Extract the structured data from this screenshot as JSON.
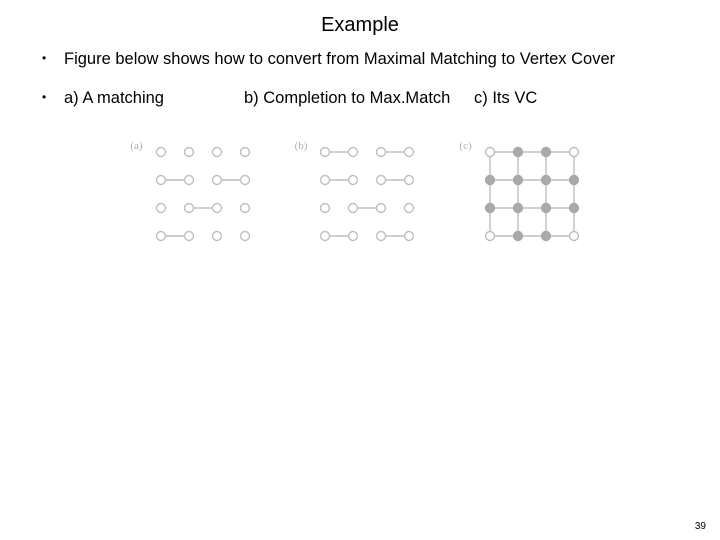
{
  "title": "Example",
  "bullet1": "Figure below shows how to convert from Maximal Matching to  Vertex Cover",
  "caption_a": "a) A matching",
  "caption_b": "b) Completion to Max.Match",
  "caption_c": "c) Its VC",
  "panel_labels": {
    "a": "(a)",
    "b": "(b)",
    "c": "(c)"
  },
  "page_number": "39",
  "chart_data": [
    {
      "type": "diagram",
      "id": "a",
      "title": "A matching",
      "grid": "4x4",
      "nodes_filled": [],
      "edges": [
        [
          [
            0,
            1
          ],
          [
            1,
            1
          ]
        ],
        [
          [
            2,
            1
          ],
          [
            3,
            1
          ]
        ],
        [
          [
            1,
            2
          ],
          [
            2,
            2
          ]
        ],
        [
          [
            0,
            3
          ],
          [
            1,
            3
          ]
        ]
      ]
    },
    {
      "type": "diagram",
      "id": "b",
      "title": "Completion to Max.Match",
      "grid": "4x4",
      "nodes_filled": [],
      "edges": [
        [
          [
            0,
            0
          ],
          [
            1,
            0
          ]
        ],
        [
          [
            2,
            0
          ],
          [
            3,
            0
          ]
        ],
        [
          [
            0,
            1
          ],
          [
            1,
            1
          ]
        ],
        [
          [
            2,
            1
          ],
          [
            3,
            1
          ]
        ],
        [
          [
            1,
            2
          ],
          [
            2,
            2
          ]
        ],
        [
          [
            0,
            3
          ],
          [
            1,
            3
          ]
        ],
        [
          [
            2,
            3
          ],
          [
            3,
            3
          ]
        ]
      ]
    },
    {
      "type": "diagram",
      "id": "c",
      "title": "Its VC",
      "grid": "4x4",
      "nodes_filled": [
        [
          1,
          0
        ],
        [
          2,
          0
        ],
        [
          0,
          1
        ],
        [
          1,
          1
        ],
        [
          2,
          1
        ],
        [
          3,
          1
        ],
        [
          0,
          2
        ],
        [
          1,
          2
        ],
        [
          2,
          2
        ],
        [
          3,
          2
        ],
        [
          1,
          3
        ],
        [
          2,
          3
        ]
      ],
      "edges": [
        [
          [
            0,
            0
          ],
          [
            1,
            0
          ]
        ],
        [
          [
            1,
            0
          ],
          [
            2,
            0
          ]
        ],
        [
          [
            2,
            0
          ],
          [
            3,
            0
          ]
        ],
        [
          [
            0,
            1
          ],
          [
            1,
            1
          ]
        ],
        [
          [
            1,
            1
          ],
          [
            2,
            1
          ]
        ],
        [
          [
            2,
            1
          ],
          [
            3,
            1
          ]
        ],
        [
          [
            0,
            2
          ],
          [
            1,
            2
          ]
        ],
        [
          [
            1,
            2
          ],
          [
            2,
            2
          ]
        ],
        [
          [
            2,
            2
          ],
          [
            3,
            2
          ]
        ],
        [
          [
            0,
            3
          ],
          [
            1,
            3
          ]
        ],
        [
          [
            1,
            3
          ],
          [
            2,
            3
          ]
        ],
        [
          [
            2,
            3
          ],
          [
            3,
            3
          ]
        ],
        [
          [
            0,
            0
          ],
          [
            0,
            1
          ]
        ],
        [
          [
            0,
            1
          ],
          [
            0,
            2
          ]
        ],
        [
          [
            0,
            2
          ],
          [
            0,
            3
          ]
        ],
        [
          [
            1,
            0
          ],
          [
            1,
            1
          ]
        ],
        [
          [
            1,
            1
          ],
          [
            1,
            2
          ]
        ],
        [
          [
            1,
            2
          ],
          [
            1,
            3
          ]
        ],
        [
          [
            2,
            0
          ],
          [
            2,
            1
          ]
        ],
        [
          [
            2,
            1
          ],
          [
            2,
            2
          ]
        ],
        [
          [
            2,
            2
          ],
          [
            2,
            3
          ]
        ],
        [
          [
            3,
            0
          ],
          [
            3,
            1
          ]
        ],
        [
          [
            3,
            1
          ],
          [
            3,
            2
          ]
        ],
        [
          [
            3,
            2
          ],
          [
            3,
            3
          ]
        ]
      ]
    }
  ]
}
